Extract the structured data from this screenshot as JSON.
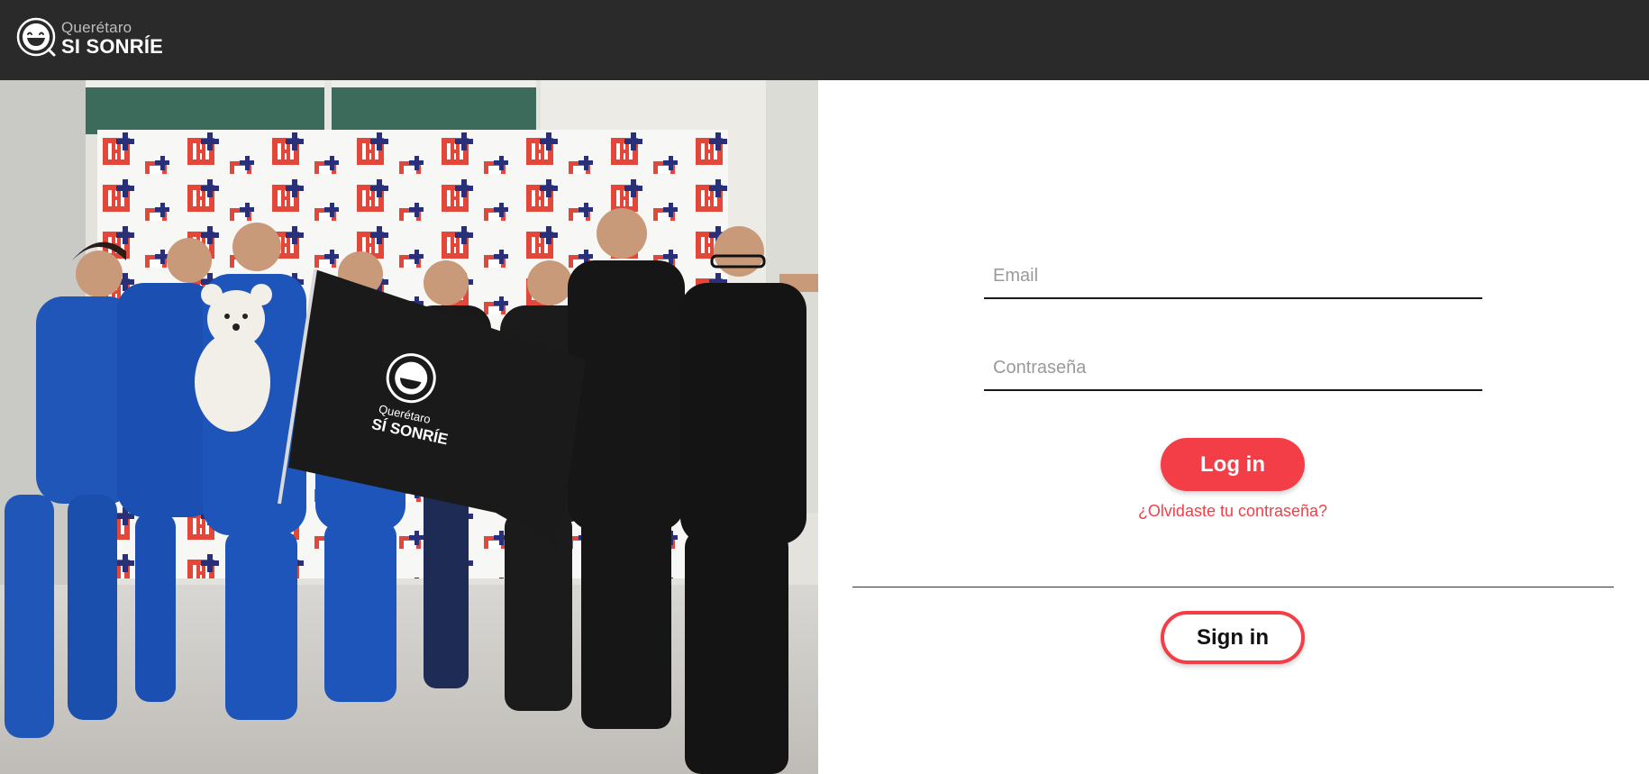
{
  "header": {
    "brand_line1": "Querétaro",
    "brand_line2": "SI SONRÍE",
    "logo_icon": "smiley-logo-icon"
  },
  "hero": {
    "image_description_icon": "team-photo-image",
    "banner_logo_line1": "Querétaro",
    "banner_logo_line2": "SÍ SONRÍE"
  },
  "login": {
    "email_placeholder": "Email",
    "password_placeholder": "Contraseña",
    "login_label": "Log in",
    "forgot_label": "¿Olvidaste tu contraseña?",
    "signin_label": "Sign in"
  },
  "colors": {
    "topbar": "#2a2a2a",
    "accent": "#f43e47",
    "background": "#ffffff"
  }
}
